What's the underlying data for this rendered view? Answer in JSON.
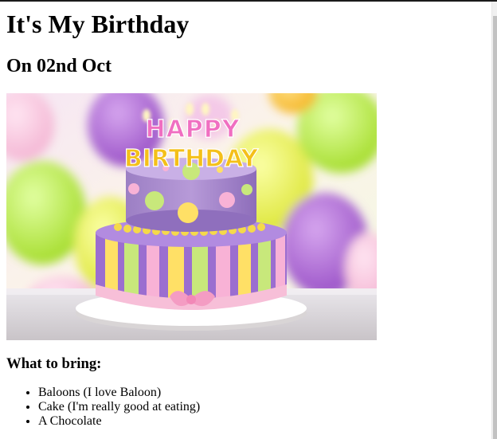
{
  "page": {
    "title": "It's My Birthday",
    "subtitle": "On 02nd Oct",
    "image": {
      "alt": "Birthday cake with Happy Birthday candles",
      "candle_top": "HAPPY",
      "candle_bottom": "BIRTHDAY"
    },
    "bring_heading": "What to bring:",
    "bring_items": [
      "Baloons (I love Baloon)",
      "Cake (I'm really good at eating)",
      "A Chocolate"
    ]
  }
}
